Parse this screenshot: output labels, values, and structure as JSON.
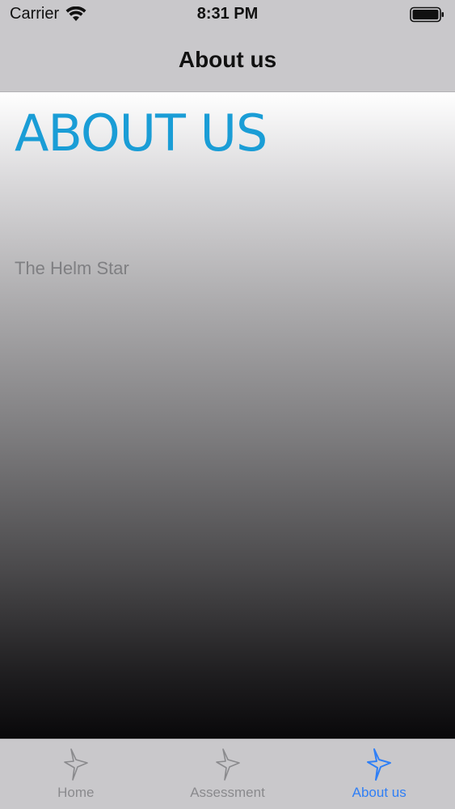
{
  "status": {
    "carrier": "Carrier",
    "time": "8:31 PM"
  },
  "nav": {
    "title": "About us"
  },
  "content": {
    "heading": "ABOUT US",
    "subtitle": "The Helm Star"
  },
  "tabs": [
    {
      "label": "Home",
      "icon": "helm-star-icon",
      "active": false
    },
    {
      "label": "Assessment",
      "icon": "helm-star-icon",
      "active": false
    },
    {
      "label": "About us",
      "icon": "helm-star-icon",
      "active": true
    }
  ],
  "colors": {
    "heading_accent": "#1a9dd6",
    "tab_active": "#2f7ff6",
    "tab_inactive": "#8a8a8d",
    "bar_background": "#c9c8cb"
  }
}
